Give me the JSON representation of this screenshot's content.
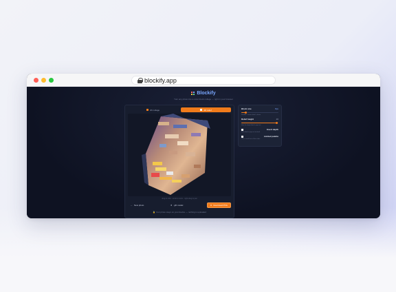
{
  "browser": {
    "url": "blockify.app"
  },
  "app": {
    "name": "Blockify",
    "tagline": "Turn any photo into a color-block collage — right in your browser"
  },
  "tabs": [
    {
      "label": "2D collage",
      "active": false
    },
    {
      "label": "3D relief",
      "active": true
    }
  ],
  "viewer": {
    "hint": "drag to orbit · scroll to zoom · right-drag to pan"
  },
  "actions": {
    "new_photo": "New photo",
    "glb_model": ".glb model",
    "download_png": "Download PNG"
  },
  "footer_note": "Your photo stays on your device — nothing is uploaded",
  "settings": {
    "block_size": {
      "label": "Block size",
      "value": "8px",
      "help": "Smaller = more detail, slower",
      "level": 0.12
    },
    "relief_height": {
      "label": "Relief height",
      "value": "20",
      "help": "How far bright blocks pop out",
      "level": 0.95
    },
    "invert_depth": {
      "label": "Invert depth",
      "help": "Dark blocks pop out instead"
    },
    "limited_palette": {
      "label": "Limited palette",
      "help": "Use a small set of flat colors"
    }
  },
  "colors": {
    "accent": "#f07b1b",
    "brand": "#7aa7ff",
    "page_bg": "#0e1222"
  }
}
